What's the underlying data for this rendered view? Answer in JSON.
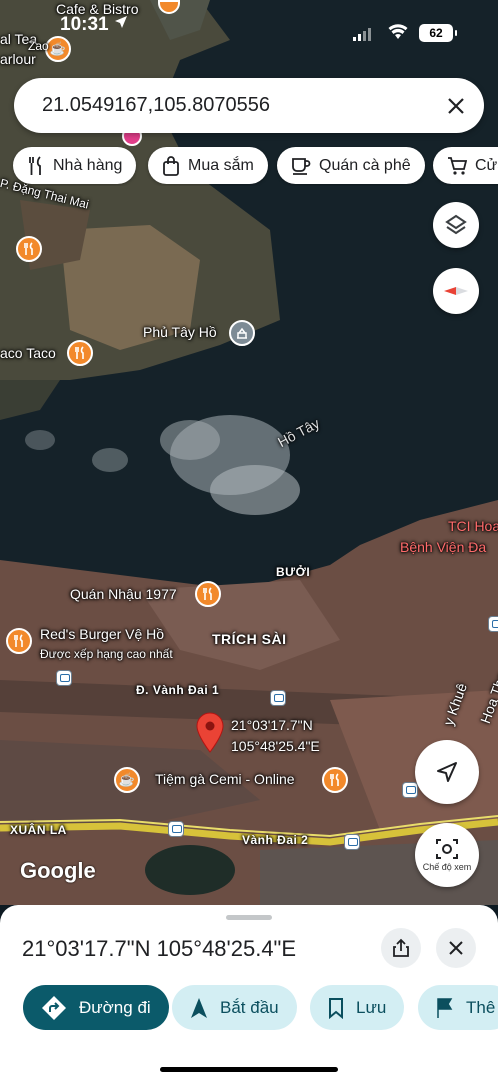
{
  "status_bar": {
    "time": "10:31",
    "battery": "62"
  },
  "search": {
    "query": "21.0549167,105.8070556"
  },
  "chips": [
    {
      "label": "Nhà hàng",
      "icon": "fork-knife-icon"
    },
    {
      "label": "Mua sắm",
      "icon": "shopping-bag-icon"
    },
    {
      "label": "Quán cà phê",
      "icon": "coffee-cup-icon"
    },
    {
      "label": "Cửa",
      "icon": "cart-icon"
    }
  ],
  "map": {
    "labels": {
      "cafe_bistro": "Cafe & Bistro",
      "al_tea": "al Tea",
      "zao": "Zao",
      "arlour": "arlour",
      "dang_thai_mai": "P. Đặng Thai Mai",
      "phu_tay_ho": "Phủ Tây Hồ",
      "aco_taco": "aco Taco",
      "ho_tay": "Hồ Tây",
      "tci": "TCI Hoa",
      "benh_vien": "Bệnh Viện Đa",
      "buoi": "BƯỞI",
      "quan_nhau": "Quán Nhậu 1977",
      "reds_burger": "Red's Burger Vệ Hồ",
      "reds_burger_sub": "Được xếp hạng cao nhất",
      "trich_sai": "TRÍCH SÀI",
      "vanh_dai_1": "Đ. Vành Đai 1",
      "pin_line1": "21°03'17.7\"N",
      "pin_line2": "105°48'25.4\"E",
      "tiem_ga": "Tiệm gà Cemi - Online",
      "xuan_la": "XUÂN LA",
      "vanh_dai_2": "Vành Đai 2",
      "khue": "y Khuê",
      "hoa_tha": "Hoa Tha",
      "google": "Google"
    },
    "streetview_label": "Chế độ xem"
  },
  "sheet": {
    "title": "21°03'17.7\"N 105°48'25.4\"E",
    "actions": [
      {
        "label": "Đường đi",
        "icon": "directions-icon"
      },
      {
        "label": "Bắt đầu",
        "icon": "navigation-arrow-icon"
      },
      {
        "label": "Lưu",
        "icon": "bookmark-icon"
      },
      {
        "label": "Thê",
        "icon": "flag-icon"
      }
    ]
  }
}
